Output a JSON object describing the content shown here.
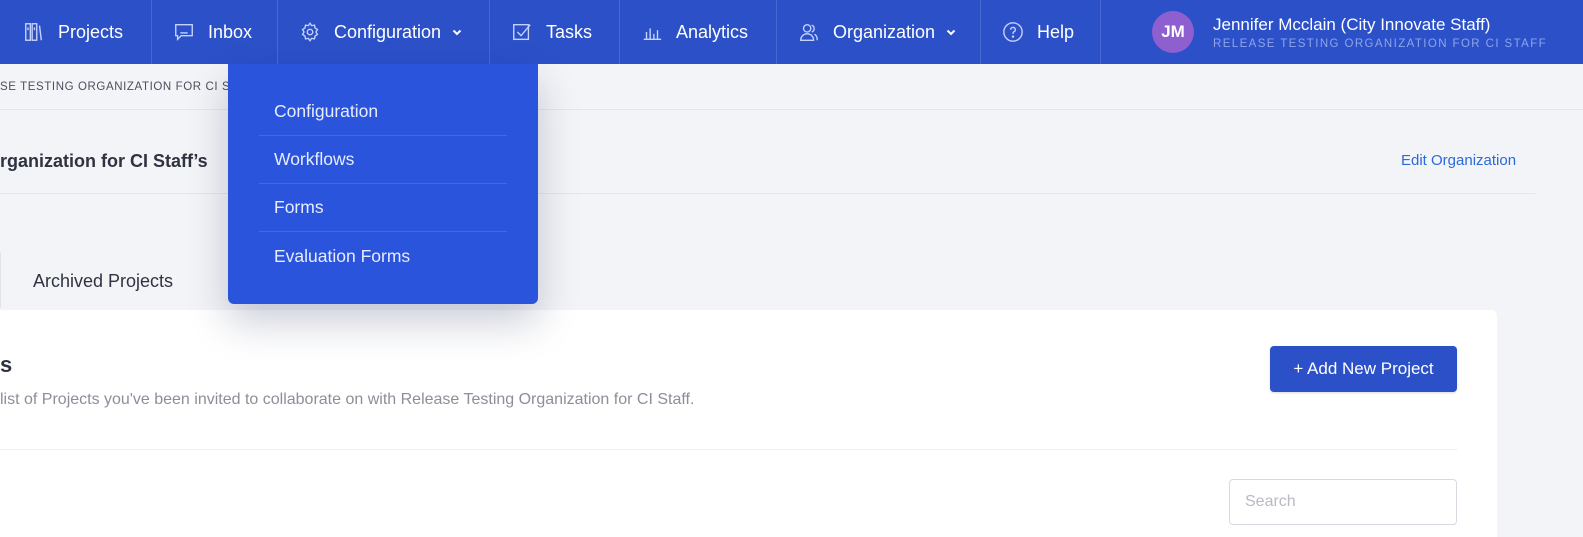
{
  "nav": {
    "items": [
      {
        "label": "Projects",
        "icon": "projects-icon"
      },
      {
        "label": "Inbox",
        "icon": "inbox-icon"
      },
      {
        "label": "Configuration",
        "icon": "gear-icon",
        "has_dropdown": true
      },
      {
        "label": "Tasks",
        "icon": "checkbox-icon"
      },
      {
        "label": "Analytics",
        "icon": "bar-chart-icon"
      },
      {
        "label": "Organization",
        "icon": "users-icon",
        "has_dropdown": true
      },
      {
        "label": "Help",
        "icon": "help-icon"
      }
    ]
  },
  "user": {
    "initials": "JM",
    "name": "Jennifer Mcclain (City Innovate Staff)",
    "organization": "RELEASE TESTING ORGANIZATION FOR CI STAFF"
  },
  "breadcrumb": "SE TESTING ORGANIZATION FOR CI ST",
  "org_header": {
    "title": "rganization for CI Staff’s",
    "edit_label": "Edit Organization"
  },
  "tabs": {
    "archived_label": "Archived Projects"
  },
  "card": {
    "title": "s",
    "description": "list of Projects you've been invited to collaborate on with Release Testing Organization for CI Staff.",
    "add_button_label": "+ Add New Project",
    "search_placeholder": "Search"
  },
  "config_dropdown": {
    "items": [
      "Configuration",
      "Workflows",
      "Forms",
      "Evaluation Forms"
    ]
  },
  "colors": {
    "nav_bg": "#2b50c8",
    "dropdown_bg": "#2b54dc",
    "avatar_bg": "#8e5fce",
    "link": "#2b6ad8"
  }
}
